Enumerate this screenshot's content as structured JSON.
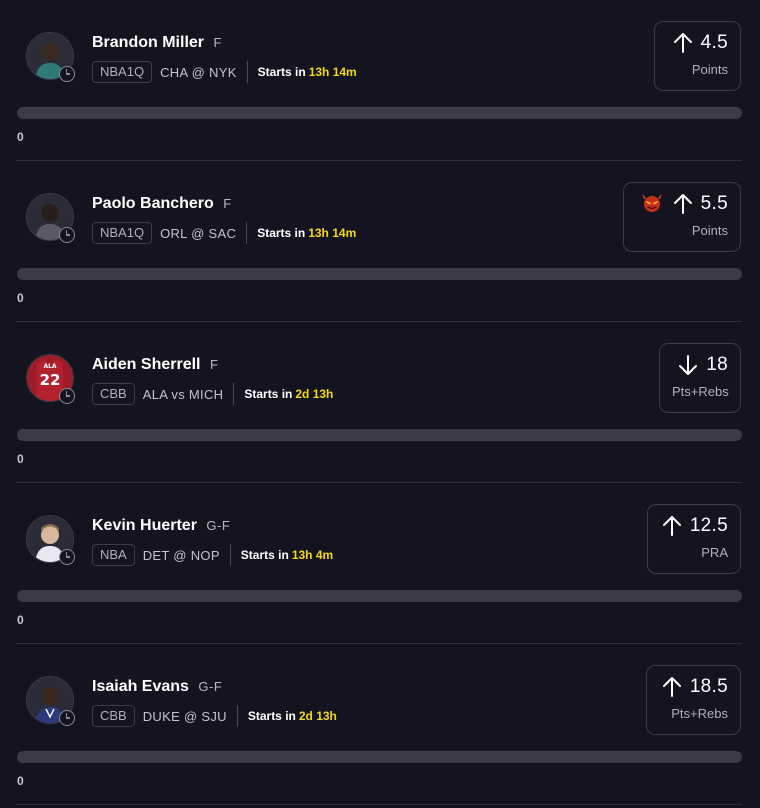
{
  "colors": {
    "background": "#141420",
    "countdown": "#f4d61a",
    "progress_track": "#3b3b47"
  },
  "props": [
    {
      "player": "Brandon Miller",
      "position": "F",
      "league": "NBA1Q",
      "matchup": "CHA @ NYK",
      "starts_label": "Starts in",
      "countdown": "13h 14m",
      "direction": "up",
      "line": "4.5",
      "stat": "Points",
      "badge": "",
      "progress": 0,
      "progress_label": "0",
      "avatar": "player-photo"
    },
    {
      "player": "Paolo Banchero",
      "position": "F",
      "league": "NBA1Q",
      "matchup": "ORL @ SAC",
      "starts_label": "Starts in",
      "countdown": "13h 14m",
      "direction": "up",
      "line": "5.5",
      "stat": "Points",
      "badge": "devil-icon",
      "progress": 0,
      "progress_label": "0",
      "avatar": "player-photo"
    },
    {
      "player": "Aiden Sherrell",
      "position": "F",
      "league": "CBB",
      "matchup": "ALA vs MICH",
      "starts_label": "Starts in",
      "countdown": "2d 13h",
      "direction": "down",
      "line": "18",
      "stat": "Pts+Rebs",
      "badge": "",
      "progress": 0,
      "progress_label": "0",
      "avatar": "jersey",
      "jersey_number": "22",
      "jersey_text": "ALA"
    },
    {
      "player": "Kevin Huerter",
      "position": "G-F",
      "league": "NBA",
      "matchup": "DET @ NOP",
      "starts_label": "Starts in",
      "countdown": "13h 4m",
      "direction": "up",
      "line": "12.5",
      "stat": "PRA",
      "badge": "",
      "progress": 0,
      "progress_label": "0",
      "avatar": "player-photo"
    },
    {
      "player": "Isaiah Evans",
      "position": "G-F",
      "league": "CBB",
      "matchup": "DUKE @ SJU",
      "starts_label": "Starts in",
      "countdown": "2d 13h",
      "direction": "up",
      "line": "18.5",
      "stat": "Pts+Rebs",
      "badge": "",
      "progress": 0,
      "progress_label": "0",
      "avatar": "player-photo"
    }
  ]
}
